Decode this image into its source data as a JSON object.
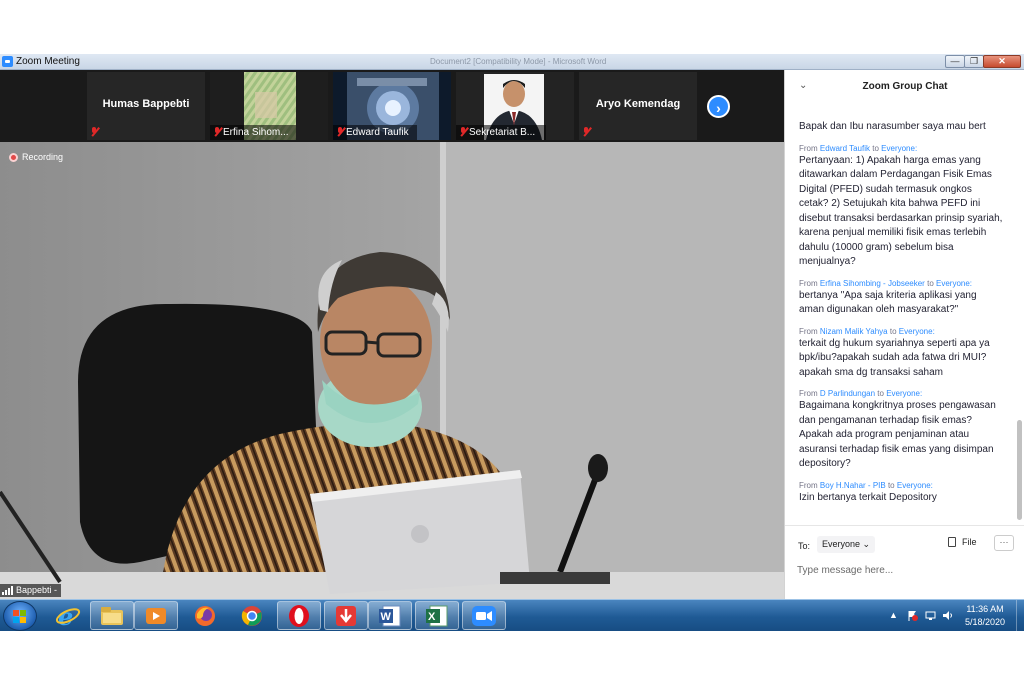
{
  "window": {
    "title": "Zoom Meeting",
    "ghost_title": "Document2 [Compatibility Mode] - Microsoft Word",
    "controls": {
      "minimize": "—",
      "maximize": "❐",
      "close": "✕"
    }
  },
  "thumbnails": [
    {
      "name": "Humas Bappebti",
      "caption": "",
      "muted": true,
      "video": false
    },
    {
      "name": "",
      "caption": "Erfina Sihom...",
      "muted": true,
      "video": true
    },
    {
      "name": "",
      "caption": "Edward Taufik",
      "muted": true,
      "video": true
    },
    {
      "name": "",
      "caption": "Sekretariat B...",
      "muted": true,
      "video": true
    },
    {
      "name": "Aryo Kemendag",
      "caption": "",
      "muted": true,
      "video": false
    }
  ],
  "main_video": {
    "recording_label": "Recording",
    "speaker_label": "Bappebti -"
  },
  "chat": {
    "title": "Zoom Group Chat",
    "collapse_icon": "chevron-down-icon",
    "messages": [
      {
        "from": "",
        "to": "",
        "text": "Bapak dan Ibu narasumber saya mau bert"
      },
      {
        "from": "Edward Taufik",
        "to": "Everyone:",
        "text": "Pertanyaan: 1) Apakah harga emas yang ditawarkan dalam Perdagangan Fisik Emas Digital (PFED) sudah termasuk ongkos cetak? 2) Setujukah kita bahwa PEFD ini disebut transaksi berdasarkan prinsip syariah, karena penjual memiliki fisik emas terlebih dahulu (10000 gram) sebelum bisa menjualnya?"
      },
      {
        "from": "Erfina Sihombing - Jobseeker",
        "to": "Everyone:",
        "text": "bertanya \"Apa saja kriteria aplikasi yang aman digunakan oleh masyarakat?\""
      },
      {
        "from": "Nizam Malik Yahya",
        "to": "Everyone:",
        "text": "terkait dg hukum syariahnya seperti apa ya bpk/ibu?apakah sudah ada fatwa dri MUI?apakah sma dg transaksi saham"
      },
      {
        "from": "D Parlindungan",
        "to": "Everyone:",
        "text": "Bagaimana kongkritnya proses pengawasan dan pengamanan terhadap fisik emas? Apakah ada program penjaminan atau asuransi terhadap fisik emas yang disimpan depository?"
      },
      {
        "from": "Boy H.Nahar - PIB",
        "to": "Everyone:",
        "text": "Izin bertanya terkait Depository"
      }
    ],
    "from_word": "From",
    "to_word": "to",
    "footer": {
      "to_label": "To:",
      "recipient": "Everyone ⌄",
      "file_label": "File",
      "more_label": "···",
      "input_placeholder": "Type message here..."
    }
  },
  "taskbar": {
    "apps": [
      "internet-explorer",
      "file-explorer",
      "media-player",
      "firefox",
      "chrome",
      "opera",
      "downloader",
      "word",
      "excel",
      "zoom"
    ],
    "clock_time": "11:36 AM",
    "clock_date": "5/18/2020"
  }
}
